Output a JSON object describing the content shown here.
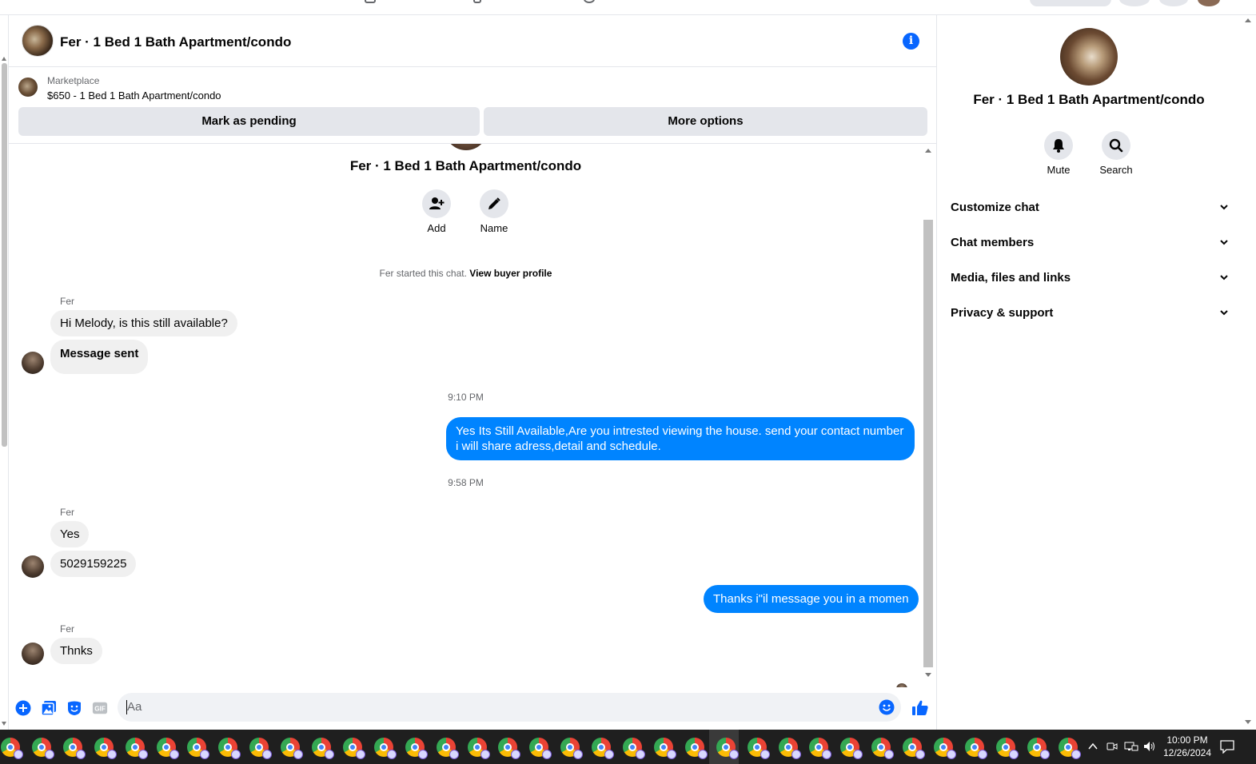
{
  "chat": {
    "title": "Fer · 1 Bed 1 Bath Apartment/condo",
    "marketplace_label": "Marketplace",
    "listing": "$650 - 1 Bed 1 Bath Apartment/condo",
    "mark_pending": "Mark as pending",
    "more_options": "More options",
    "intro_title": "Fer · 1 Bed 1 Bath Apartment/condo",
    "add_label": "Add",
    "name_label": "Name",
    "started_text": "Fer started this chat.",
    "view_profile": "View buyer profile"
  },
  "messages": {
    "group1_sender": "Fer",
    "msg1": "Hi Melody, is this still available?",
    "msg2": "Message sent",
    "time1": "9:10 PM",
    "out1": "Yes Its Still Available,Are you intrested viewing the house. send your contact number i will share adress,detail and schedule.",
    "time2": "9:58 PM",
    "group2_sender": "Fer",
    "msg3": "Yes",
    "msg4": "5029159225",
    "out2": "Thanks i\"il message you in a momen",
    "group3_sender": "Fer",
    "msg5": "Thnks"
  },
  "composer": {
    "placeholder": "Aa"
  },
  "info_panel": {
    "name": "Fer · 1 Bed 1 Bath Apartment/condo",
    "mute": "Mute",
    "search": "Search",
    "sections": [
      "Customize chat",
      "Chat members",
      "Media, files and links",
      "Privacy & support"
    ]
  },
  "taskbar": {
    "time": "10:00 PM",
    "date": "12/26/2024"
  },
  "colors": {
    "accent": "#0084ff",
    "icon_blue": "#0866ff",
    "bubble_gray": "#f0f0f0",
    "button_gray": "#e4e6eb"
  }
}
